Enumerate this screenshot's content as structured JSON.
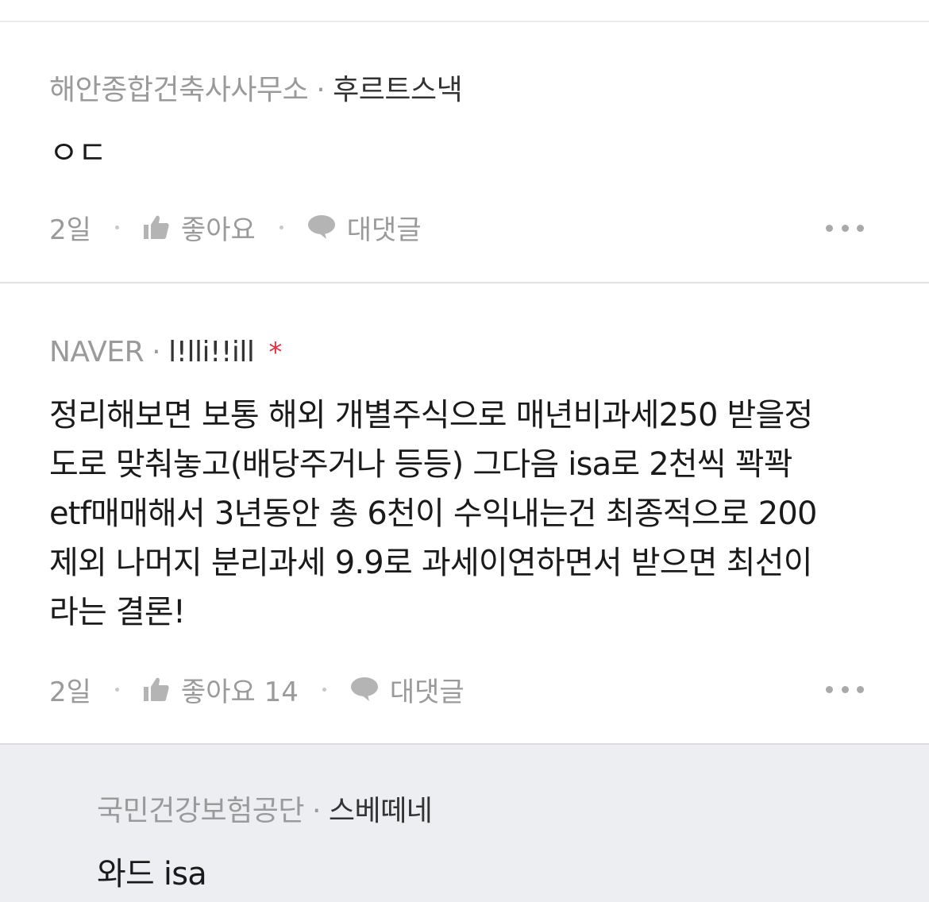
{
  "comments": [
    {
      "org": "해안종합건축사사무소",
      "nick": "후르트스낵",
      "body": "ㅇㄷ",
      "time": "2일",
      "like_label": "좋아요",
      "reply_label": "대댓글"
    },
    {
      "org": "NAVER",
      "nick": "l!lli!!ill",
      "star": "*",
      "body": "정리해보면 보통 해외 개별주식으로 매년비과세250 받을정\n도로 맞춰놓고(배당주거나 등등) 그다음 isa로 2천씩 꽉꽉\netf매매해서 3년동안 총 6천이 수익내는건 최종적으로 200\n제외 나머지 분리과세 9.9로 과세이연하면서 받으면 최선이\n라는 결론!",
      "time": "2일",
      "like_label": "좋아요 14",
      "reply_label": "대댓글"
    }
  ],
  "reply": {
    "org": "국민건강보험공단",
    "nick": "스베떼네",
    "body": "와드 isa"
  },
  "separator": "·",
  "icons": {
    "like": "thumbs-up-icon",
    "reply": "speech-bubble-icon",
    "more": "more-dots-icon"
  },
  "colors": {
    "meta_gray": "#9a9a9a",
    "nick_dark": "#333333",
    "body_text": "#1a1a1a",
    "star_red": "#e0323c",
    "reply_bg": "#eceef1"
  }
}
